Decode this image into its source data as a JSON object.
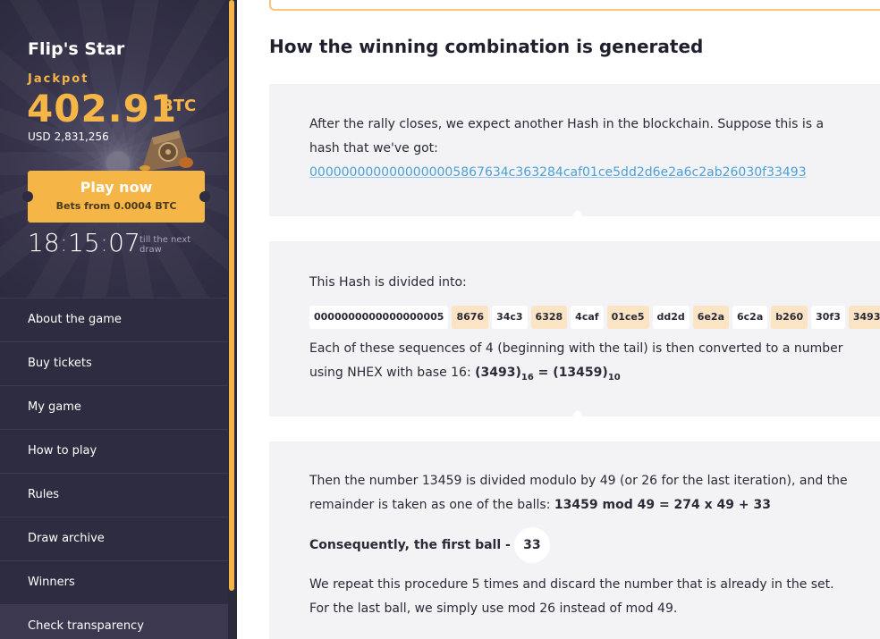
{
  "sidebar": {
    "brand": "Flip's Star",
    "jackpot_label": "Jackpot",
    "jackpot_value": "402.91",
    "jackpot_currency": "BTC",
    "usd_label": "USD",
    "usd_value": "2,831,256",
    "play_title": "Play now",
    "play_subtitle": "Bets from 0.0004 BTC",
    "timer": {
      "h": "18",
      "m": "15",
      "s": "07"
    },
    "till_next": "till the next draw",
    "menu": [
      {
        "label": "About the game"
      },
      {
        "label": "Buy tickets"
      },
      {
        "label": "My game"
      },
      {
        "label": "How to play"
      },
      {
        "label": "Rules"
      },
      {
        "label": "Draw archive"
      },
      {
        "label": "Winners"
      },
      {
        "label": "Check transparency"
      }
    ]
  },
  "main": {
    "heading": "How the winning combination is generated",
    "card1": {
      "text": "After the rally closes, we expect another Hash in the blockchain. Suppose this is a hash that we've got:",
      "hash": "0000000000000000005867634c363284caf01ce5dd2d6e2a6c2ab26030f33493"
    },
    "card2": {
      "intro": "This Hash is divided into:",
      "segments": [
        {
          "text": "0000000000000000005",
          "style": "w"
        },
        {
          "text": "8676",
          "style": "o"
        },
        {
          "text": "34c3",
          "style": "w"
        },
        {
          "text": "6328",
          "style": "o"
        },
        {
          "text": "4caf",
          "style": "w"
        },
        {
          "text": "01ce5",
          "style": "o"
        },
        {
          "text": "dd2d",
          "style": "w"
        },
        {
          "text": "6e2a",
          "style": "o"
        },
        {
          "text": "6c2a",
          "style": "w"
        },
        {
          "text": "b260",
          "style": "o"
        },
        {
          "text": "30f3",
          "style": "w"
        },
        {
          "text": "3493",
          "style": "o"
        }
      ],
      "conversion_text": "Each of these sequences of 4 (beginning with the tail) is then converted to a number using NHEX with base 16:",
      "formula_left": "(3493)",
      "formula_left_sub": "16",
      "formula_eq": " = ",
      "formula_right": "(13459)",
      "formula_right_sub": "10"
    },
    "card3": {
      "text": "Then the number 13459 is divided modulo by 49 (or 26 for the last iteration), and the remainder is taken as one of the balls:",
      "formula": "13459 mod 49 = 274 x 49 + 33",
      "first_ball_label": "Consequently, the first ball -",
      "first_ball_value": "33",
      "repeat_text": "We repeat this procedure 5 times and discard the number that is already in the set. For the last ball, we simply use mod 26 instead of mod 49."
    }
  },
  "colors": {
    "accent": "#f5b547",
    "sidebar": "#2e2c40",
    "card": "#f3f3f5",
    "link": "#4aa0d8",
    "segment_highlight": "#fbe4c4"
  }
}
